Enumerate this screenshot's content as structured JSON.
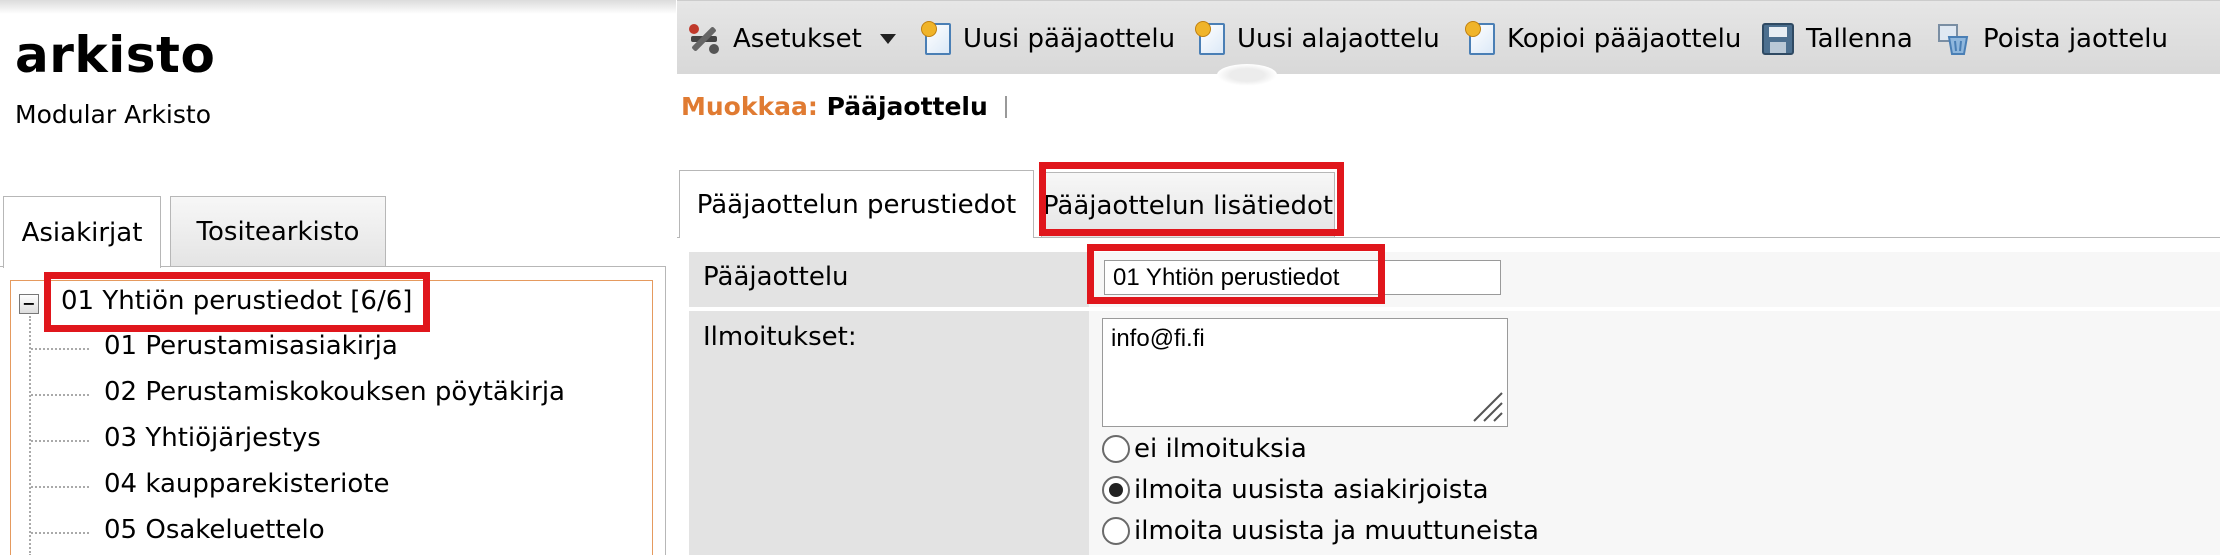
{
  "app": {
    "title": "arkisto",
    "subtitle": "Modular Arkisto"
  },
  "left_tabs": [
    {
      "label": "Asiakirjat",
      "active": true
    },
    {
      "label": "Tositearkisto",
      "active": false
    }
  ],
  "tree": {
    "toggle_symbol": "−",
    "root_label": "01 Yhtiön perustiedot [6/6]",
    "children": [
      "01 Perustamisasiakirja",
      "02 Perustamiskokouksen pöytäkirja",
      "03 Yhtiöjärjestys",
      "04 kaupparekisteriote",
      "05 Osakeluettelo"
    ]
  },
  "toolbar": {
    "settings_label": "Asetukset",
    "new_main_label": "Uusi pääjaottelu",
    "new_sub_label": "Uusi alajaottelu",
    "copy_main_label": "Kopioi pääjaottelu",
    "save_label": "Tallenna",
    "delete_label": "Poista jaottelu"
  },
  "edit_heading": {
    "prefix": "Muokkaa:",
    "subject": "Pääjaottelu"
  },
  "content_tabs": [
    {
      "label": "Pääjaottelun perustiedot",
      "active": true
    },
    {
      "label": "Pääjaottelun lisätiedot",
      "active": false
    }
  ],
  "form": {
    "paajaottelu_label": "Pääjaottelu",
    "paajaottelu_value": "01 Yhtiön perustiedot",
    "ilmoitukset_label": "Ilmoitukset:",
    "ilmoitukset_value": "info@fi.fi",
    "notify_options": [
      {
        "label": "ei ilmoituksia",
        "checked": false
      },
      {
        "label": "ilmoita uusista asiakirjoista",
        "checked": true
      },
      {
        "label": "ilmoita uusista ja muuttuneista",
        "checked": false
      }
    ]
  },
  "colors": {
    "accent_orange": "#e07b32",
    "highlight_red": "#e0161c",
    "label_column": "#e3e3e3",
    "tree_border": "#e59a5e"
  }
}
